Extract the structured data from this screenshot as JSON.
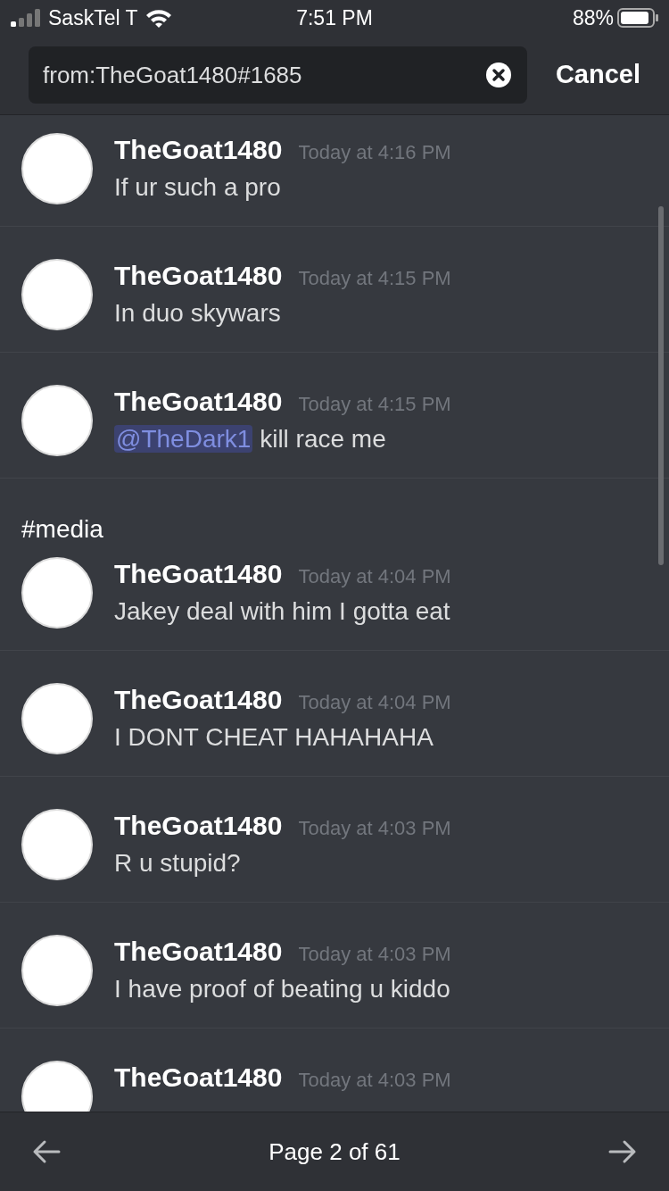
{
  "status_bar": {
    "carrier": "SaskTel T",
    "time": "7:51 PM",
    "battery": "88%"
  },
  "search": {
    "value": "from:TheGoat1480#1685",
    "cancel": "Cancel"
  },
  "groups": [
    {
      "messages": [
        {
          "author": "TheGoat1480",
          "time": "Today at 4:16 PM",
          "body": [
            {
              "kind": "text",
              "text": "If ur such a pro"
            }
          ]
        },
        {
          "author": "TheGoat1480",
          "time": "Today at 4:15 PM",
          "body": [
            {
              "kind": "text",
              "text": "In duo skywars"
            }
          ]
        },
        {
          "author": "TheGoat1480",
          "time": "Today at 4:15 PM",
          "body": [
            {
              "kind": "mention",
              "text": "@TheDark1"
            },
            {
              "kind": "text",
              "text": " kill race me"
            }
          ]
        }
      ]
    },
    {
      "channel": "#media",
      "messages": [
        {
          "author": "TheGoat1480",
          "time": "Today at 4:04 PM",
          "body": [
            {
              "kind": "text",
              "text": "Jakey deal with him I gotta eat"
            }
          ]
        },
        {
          "author": "TheGoat1480",
          "time": "Today at 4:04 PM",
          "body": [
            {
              "kind": "text",
              "text": "I DONT CHEAT HAHAHAHA"
            }
          ]
        },
        {
          "author": "TheGoat1480",
          "time": "Today at 4:03 PM",
          "body": [
            {
              "kind": "text",
              "text": "R u stupid?"
            }
          ]
        },
        {
          "author": "TheGoat1480",
          "time": "Today at 4:03 PM",
          "body": [
            {
              "kind": "text",
              "text": "I have proof of beating u kiddo"
            }
          ]
        },
        {
          "author": "TheGoat1480",
          "time": "Today at 4:03 PM"
        }
      ]
    }
  ],
  "pager": {
    "label": "Page 2 of 61"
  }
}
